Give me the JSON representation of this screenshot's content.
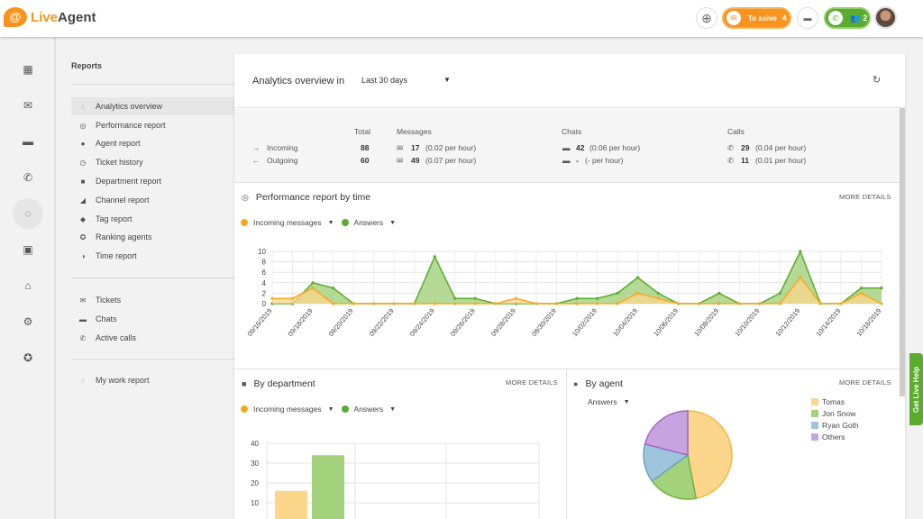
{
  "app": {
    "name_a": "Live",
    "name_b": "Agent",
    "logo_mark": "@"
  },
  "topbar": {
    "to_solve_label": "To solve",
    "to_solve_count": "4",
    "calls_count": "2"
  },
  "menu": {
    "title": "Reports",
    "items": [
      "Analytics overview",
      "Performance report",
      "Agent report",
      "Ticket history",
      "Department report",
      "Channel report",
      "Tag report",
      "Ranking agents",
      "Time report"
    ],
    "items2": [
      "Tickets",
      "Chats",
      "Active calls"
    ],
    "items3": [
      "My work report"
    ]
  },
  "header": {
    "title": "Analytics overview in",
    "period": "Last 30 days"
  },
  "stats": {
    "headers": {
      "total": "Total",
      "messages": "Messages",
      "chats": "Chats",
      "calls": "Calls"
    },
    "incoming": {
      "label": "Incoming",
      "total": "88",
      "messages": "17",
      "messages_rate": "(0.02 per hour)",
      "chats": "42",
      "chats_rate": "(0.06 per hour)",
      "calls": "29",
      "calls_rate": "(0.04 per hour)"
    },
    "outgoing": {
      "label": "Outgoing",
      "total": "60",
      "messages": "49",
      "messages_rate": "(0.07 per hour)",
      "chats": "-",
      "chats_rate": "(- per hour)",
      "calls": "11",
      "calls_rate": "(0.01 per hour)"
    }
  },
  "perf": {
    "title": "Performance report by time",
    "more": "MORE DETAILS",
    "legend1": "Incoming messages",
    "legend2": "Answers"
  },
  "dept": {
    "title": "By department",
    "more": "MORE DETAILS",
    "legend1": "Incoming messages",
    "legend2": "Answers"
  },
  "agent": {
    "title": "By agent",
    "more": "MORE DETAILS",
    "select": "Answers"
  },
  "help_tab": "Get Live Help",
  "colors": {
    "orange": "#f7a823",
    "orange_fill": "#fbd58a",
    "green": "#5aab2e",
    "green_fill": "#a3d17c",
    "blue_fill": "#9fc5dc",
    "purple_fill": "#c7a3e0"
  },
  "chart_data": [
    {
      "type": "area",
      "title": "Performance report by time",
      "x": [
        "09/16/2019",
        "09/17/2019",
        "09/18/2019",
        "09/19/2019",
        "09/20/2019",
        "09/21/2019",
        "09/22/2019",
        "09/23/2019",
        "09/24/2019",
        "09/25/2019",
        "09/26/2019",
        "09/27/2019",
        "09/28/2019",
        "09/29/2019",
        "09/30/2019",
        "10/01/2019",
        "10/02/2019",
        "10/03/2019",
        "10/04/2019",
        "10/05/2019",
        "10/06/2019",
        "10/07/2019",
        "10/08/2019",
        "10/09/2019",
        "10/10/2019",
        "10/11/2019",
        "10/12/2019",
        "10/13/2019",
        "10/14/2019",
        "10/15/2019",
        "10/16/2019"
      ],
      "x_ticks": [
        "09/16/2019",
        "09/18/2019",
        "09/20/2019",
        "09/22/2019",
        "09/24/2019",
        "09/26/2019",
        "09/28/2019",
        "09/30/2019",
        "10/02/2019",
        "10/04/2019",
        "10/06/2019",
        "10/08/2019",
        "10/10/2019",
        "10/12/2019",
        "10/14/2019",
        "10/16/2019"
      ],
      "series": [
        {
          "name": "Incoming messages",
          "values": [
            1,
            1,
            3,
            0,
            0,
            0,
            0,
            0,
            0,
            0,
            0,
            0,
            1,
            0,
            0,
            0,
            0,
            0,
            2,
            1,
            0,
            0,
            0,
            0,
            0,
            0,
            5,
            0,
            0,
            2,
            0
          ]
        },
        {
          "name": "Answers",
          "values": [
            0,
            0,
            4,
            3,
            0,
            0,
            0,
            0,
            9,
            1,
            1,
            0,
            0,
            0,
            0,
            1,
            1,
            2,
            5,
            2,
            0,
            0,
            2,
            0,
            0,
            2,
            10,
            0,
            0,
            3,
            3
          ]
        }
      ],
      "ylim": [
        0,
        10
      ],
      "y_ticks": [
        0,
        2,
        4,
        6,
        8,
        10
      ]
    },
    {
      "type": "bar",
      "title": "By department",
      "categories": [
        ""
      ],
      "series": [
        {
          "name": "Incoming messages",
          "values": [
            16
          ]
        },
        {
          "name": "Answers",
          "values": [
            34
          ]
        }
      ],
      "ylim": [
        0,
        40
      ],
      "y_ticks": [
        10,
        20,
        30,
        40
      ]
    },
    {
      "type": "pie",
      "title": "By agent",
      "labels": [
        "Tomas",
        "Jon Snow",
        "Ryan Goth",
        "Others"
      ],
      "values": [
        47,
        18,
        14,
        21
      ]
    }
  ]
}
